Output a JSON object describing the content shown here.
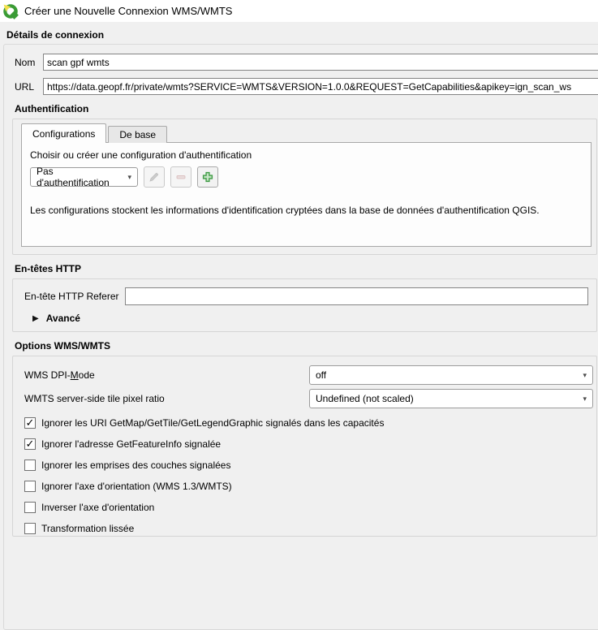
{
  "window": {
    "title": "Créer une Nouvelle Connexion WMS/WMTS",
    "icon": "qgis-logo"
  },
  "icons": {
    "dropdown_arrow": "▾",
    "collapsed_arrow": "▶",
    "check_glyph": "✓"
  },
  "colors": {
    "dialog_bg": "#f0f0f0",
    "titlebar_bg": "#ffffff",
    "pane_bg": "#fdfdfd",
    "add_icon_green": "#3f9b45",
    "remove_icon_pink": "#dbc0c0",
    "edit_icon_gray": "#cccccc"
  },
  "details": {
    "header": "Détails de connexion",
    "name_label": "Nom",
    "name_value": "scan gpf wmts",
    "url_label": "URL",
    "url_value": "https://data.geopf.fr/private/wmts?SERVICE=WMTS&VERSION=1.0.0&REQUEST=GetCapabilities&apikey=ign_scan_ws"
  },
  "auth": {
    "header": "Authentification",
    "tabs": [
      {
        "label": "Configurations",
        "active": true
      },
      {
        "label": "De base",
        "active": false
      }
    ],
    "choose_label": "Choisir ou créer une configuration d'authentification",
    "config_value": "Pas d'authentification",
    "edit_disabled": true,
    "remove_disabled": true,
    "add_disabled": false,
    "info_text": "Les configurations stockent les informations d'identification cryptées dans la base de données d'authentification QGIS."
  },
  "http_headers": {
    "header": "En-têtes HTTP",
    "referer_label": "En-tête HTTP Referer",
    "referer_value": "",
    "advanced_label": "Avancé"
  },
  "wms_options": {
    "header": "Options WMS/WMTS",
    "dpi_mode": {
      "label_pre": "WMS DPI-",
      "label_mnemonic": "M",
      "label_post": "ode",
      "value": "off"
    },
    "tile_ratio": {
      "label": "WMTS server-side tile pixel ratio",
      "value": "Undefined (not scaled)"
    },
    "checkboxes": [
      {
        "label": "Ignorer les URI GetMap/GetTile/GetLegendGraphic signalés dans les capacités",
        "checked": true
      },
      {
        "label": "Ignorer l'adresse GetFeatureInfo signalée",
        "checked": true
      },
      {
        "label": "Ignorer les emprises des couches signalées",
        "checked": false
      },
      {
        "label": "Ignorer l'axe d'orientation (WMS 1.3/WMTS)",
        "checked": false
      },
      {
        "label": "Inverser l'axe d'orientation",
        "checked": false
      },
      {
        "label": "Transformation lissée",
        "checked": false
      }
    ]
  }
}
